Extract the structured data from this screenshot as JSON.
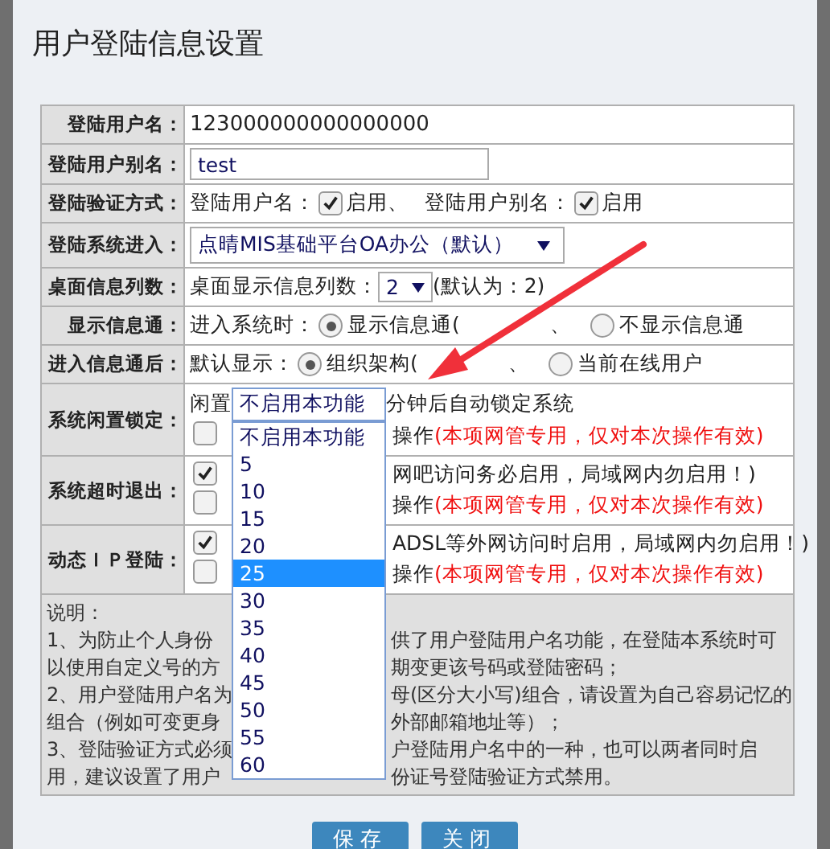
{
  "dialog": {
    "title": "用户登陆信息设置"
  },
  "rows": [
    {
      "label": "登陆用户名：",
      "kind": "text",
      "value": "123000000000000000"
    },
    {
      "label": "登陆用户别名：",
      "kind": "input",
      "value": "test"
    },
    {
      "label": "登陆验证方式：",
      "kind": "checks",
      "items": [
        {
          "label": "登陆用户名：",
          "checked": true,
          "suffix": "启用、"
        },
        {
          "label": "登陆用户别名：",
          "checked": true,
          "suffix": "启用"
        }
      ]
    },
    {
      "label": "登陆系统进入：",
      "kind": "select",
      "value": "点晴MIS基础平台OA办公（默认）"
    },
    {
      "label": "桌面信息列数：",
      "kind": "small-select",
      "prefix": "桌面显示信息列数：",
      "value": "2",
      "suffix": "(默认为：2)"
    },
    {
      "label": "显示信息通：",
      "kind": "radios",
      "prefix": "进入系统时：",
      "options": [
        {
          "label": "显示信息通(",
          "tail": "、",
          "selected": true
        },
        {
          "label": "不显示信息通",
          "selected": false
        }
      ]
    },
    {
      "label": "进入信息通后：",
      "kind": "radios",
      "prefix": "默认显示：",
      "options": [
        {
          "label": "组织架构(",
          "tail": "、",
          "selected": true
        },
        {
          "label": "当前在线用户",
          "selected": false
        }
      ]
    },
    {
      "label": "系统闲置锁定：",
      "kind": "lines",
      "lines": [
        {
          "kind": "select",
          "prefix": "闲置",
          "value": "不启用本功能",
          "suffix": "分钟后自动锁定系统"
        },
        {
          "kind": "check",
          "checked": false,
          "text": "操作",
          "note": "(本项网管专用，仅对本次操作有效)"
        }
      ]
    },
    {
      "label": "系统超时退出：",
      "kind": "lines",
      "lines": [
        {
          "kind": "check",
          "checked": true,
          "text": "网吧访问务必启用，局域网内勿启用！)"
        },
        {
          "kind": "check",
          "checked": false,
          "text": "操作",
          "note": "(本项网管专用，仅对本次操作有效)"
        }
      ]
    },
    {
      "label": "动态ＩＰ登陆：",
      "kind": "lines",
      "lines": [
        {
          "kind": "check",
          "checked": true,
          "text": "ADSL等外网访问时启用，局域网内勿启用！)"
        },
        {
          "kind": "check",
          "checked": false,
          "text": "操作",
          "note": "(本项网管专用，仅对本次操作有效)"
        }
      ]
    }
  ],
  "dropdown": {
    "options": [
      {
        "label": "不启用本功能",
        "selected": false
      },
      {
        "label": "5",
        "selected": false
      },
      {
        "label": "10",
        "selected": false
      },
      {
        "label": "15",
        "selected": false
      },
      {
        "label": "20",
        "selected": false
      },
      {
        "label": "25",
        "selected": true
      },
      {
        "label": "30",
        "selected": false
      },
      {
        "label": "35",
        "selected": false
      },
      {
        "label": "40",
        "selected": false
      },
      {
        "label": "45",
        "selected": false
      },
      {
        "label": "50",
        "selected": false
      },
      {
        "label": "55",
        "selected": false
      },
      {
        "label": "60",
        "selected": false
      }
    ]
  },
  "notes": [
    {
      "left": "说明："
    },
    {
      "left": "1、为防止个人身份",
      "right": "供了用户登陆用户名功能，在登陆本系统时可"
    },
    {
      "left": "以使用自定义号的方",
      "right": "期变更该号码或登陆密码；"
    },
    {
      "left": "2、用户登陆用户名为",
      "right": "母(区分大小写)组合，请设置为自己容易记忆的"
    },
    {
      "left": "组合（例如可变更身",
      "right": "外部邮箱地址等）；"
    },
    {
      "left": "3、登陆验证方式必须",
      "right": "户登陆用户名中的一种，也可以两者同时启"
    },
    {
      "left": "用，建议设置了用户",
      "right": "份证号登陆验证方式禁用。"
    }
  ],
  "buttons": [
    "保存",
    "关闭"
  ]
}
